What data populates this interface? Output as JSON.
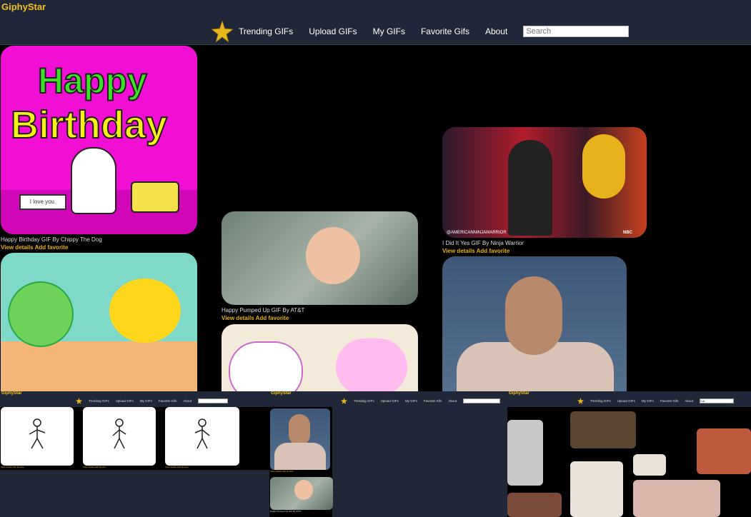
{
  "app": {
    "brand": "GiphyStar"
  },
  "nav": {
    "items": [
      "Trending GIFs",
      "Upload GIFs",
      "My GIFs",
      "Favorite Gifs",
      "About"
    ],
    "search_placeholder": "Search"
  },
  "gifs": [
    {
      "title": "Happy Birthday GIF By Chippy The Dog",
      "sign_text": "I love you."
    },
    {
      "title": ""
    },
    {
      "title": "Happy Pumped Up GIF By AT&T"
    },
    {
      "title": ""
    },
    {
      "title": "I Did It Yes GIF By Ninja Warrior",
      "watermark": "@AMERICANNINJAWARRIOR",
      "network": "NBC"
    },
    {
      "title": ""
    }
  ],
  "card_links": {
    "details": "View details",
    "favorite": "Add favorite"
  },
  "preview_strip": {
    "brands": [
      "GiphyStar",
      "GiphyStar",
      "GiphyStar"
    ],
    "search_value_3": "Cat"
  },
  "colors": {
    "nav_bg": "#1f2738",
    "accent": "#e8b20c",
    "brand": "#f3c11a",
    "page_bg": "#000000"
  }
}
